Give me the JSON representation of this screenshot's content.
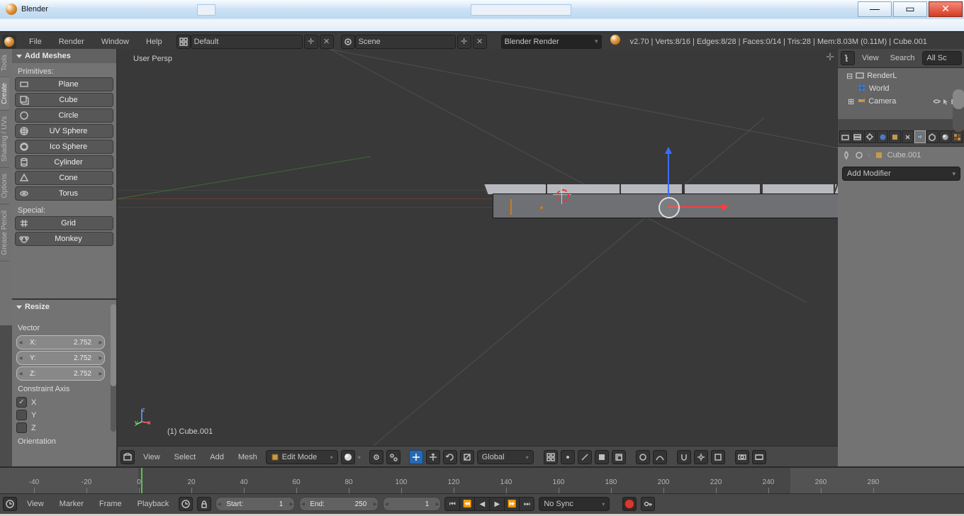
{
  "window": {
    "title": "Blender"
  },
  "menubar": {
    "items": [
      "File",
      "Render",
      "Window",
      "Help"
    ],
    "layout": "Default",
    "scene": "Scene",
    "engine": "Blender Render",
    "stats": "v2.70 | Verts:8/16 | Edges:8/28 | Faces:0/14 | Tris:28 | Mem:8.03M (0.11M) | Cube.001"
  },
  "minitabs": [
    "Tools",
    "Create",
    "Shading / UVs",
    "Options",
    "Grease Pencil"
  ],
  "toolpanel": {
    "title": "Add Meshes",
    "section1": "Primitives:",
    "primitives": [
      "Plane",
      "Cube",
      "Circle",
      "UV Sphere",
      "Ico Sphere",
      "Cylinder",
      "Cone",
      "Torus"
    ],
    "section2": "Special:",
    "specials": [
      "Grid",
      "Monkey"
    ]
  },
  "operator": {
    "title": "Resize",
    "vectorLabel": "Vector",
    "vector": {
      "x": "2.752",
      "y": "2.752",
      "z": "2.752"
    },
    "axesLabel": "Constraint Axis",
    "axes": {
      "x": "X",
      "y": "Y",
      "z": "Z"
    },
    "orientationLabel": "Orientation"
  },
  "view3d": {
    "persp": "User Persp",
    "objname": "(1) Cube.001",
    "header": {
      "menus": [
        "View",
        "Select",
        "Add",
        "Mesh"
      ],
      "mode": "Edit Mode",
      "orientation": "Global"
    }
  },
  "outliner": {
    "menus": [
      "View",
      "Search"
    ],
    "filter": "All Sc",
    "rows": [
      "RenderL",
      "World",
      "Camera"
    ]
  },
  "properties": {
    "object": "Cube.001",
    "addmod": "Add Modifier"
  },
  "timeline": {
    "ticks": [
      "-40",
      "-20",
      "0",
      "20",
      "40",
      "60",
      "80",
      "100",
      "120",
      "140",
      "160",
      "180",
      "200",
      "220",
      "240",
      "260",
      "280"
    ],
    "menus": [
      "View",
      "Marker",
      "Frame",
      "Playback"
    ],
    "start": {
      "label": "Start:",
      "value": "1"
    },
    "end": {
      "label": "End:",
      "value": "250"
    },
    "cur": {
      "value": "1"
    },
    "sync": "No Sync"
  }
}
